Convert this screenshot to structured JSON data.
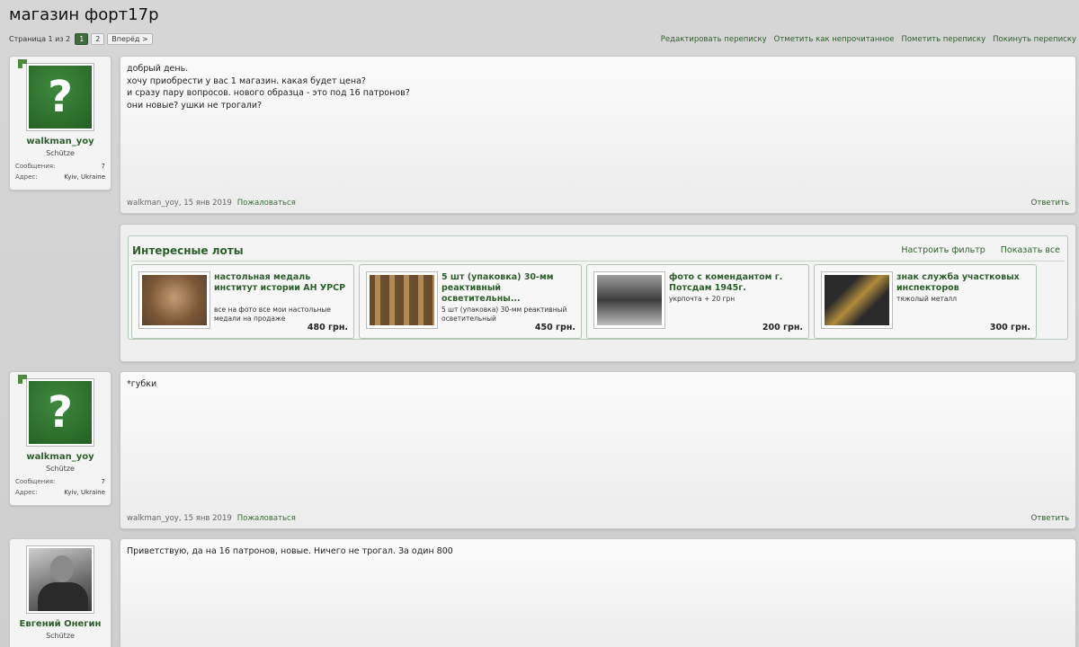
{
  "page": {
    "title": "магазин форт17р",
    "pagination": {
      "label": "Страница 1 из 2",
      "pages": [
        "1",
        "2"
      ],
      "current": "1",
      "next": "Вперёд >"
    },
    "actions": [
      "Редактировать переписку",
      "Отметить как непрочитанное",
      "Пометить переписку",
      "Покинуть переписку"
    ]
  },
  "posts": [
    {
      "user": {
        "name": "walkman_yoy",
        "title": "Schütze",
        "messages_label": "Сообщения:",
        "messages": "7",
        "address_label": "Адрес:",
        "address": "Kyiv, Ukraine",
        "avatar": "question-mark"
      },
      "text": "добрый день.\nхочу приобрести у вас 1 магазин. какая будет цена?\nи сразу пару вопросов. нового образца - это под 16 патронов?\nони новые? ушки не трогали?",
      "meta": "walkman_yoy, 15 янв 2019",
      "report": "Пожаловаться",
      "reply": "Ответить"
    },
    {
      "user": {
        "name": "walkman_yoy",
        "title": "Schütze",
        "messages_label": "Сообщения:",
        "messages": "7",
        "address_label": "Адрес:",
        "address": "Kyiv, Ukraine",
        "avatar": "question-mark"
      },
      "text": "*губки",
      "meta": "walkman_yoy, 15 янв 2019",
      "report": "Пожаловаться",
      "reply": "Ответить"
    },
    {
      "user": {
        "name": "Евгений Онегин",
        "title": "Schütze",
        "avatar": "photo"
      },
      "text": "Приветствую, да на 16 патронов, новые. Ничего не трогал. За один 800"
    }
  ],
  "lots": {
    "title": "Интересные лоты",
    "links": [
      "Настроить фильтр",
      "Показать все"
    ],
    "items": [
      {
        "title": "настольная медаль институт истории АН УРСР",
        "desc": "все на фото все мои настольные медали на продаже",
        "price": "480 грн.",
        "thumb_color": "#9a7a5a"
      },
      {
        "title": "5 шт (упаковка) 30-мм реактивный осветительны...",
        "desc": "5 шт (упаковка) 30-мм реактивный осветительный",
        "price": "450 грн.",
        "thumb_color": "#8a6d4a"
      },
      {
        "title": "фото с комендантом г. Потсдам 1945г.",
        "desc": "укрпочта + 20 грн",
        "price": "200 грн.",
        "thumb_color": "#6f6f6f"
      },
      {
        "title": "знак служба участковых инспекторов",
        "desc": "тяжолый металл",
        "price": "300 грн.",
        "thumb_color": "#7a6a3a"
      }
    ]
  }
}
